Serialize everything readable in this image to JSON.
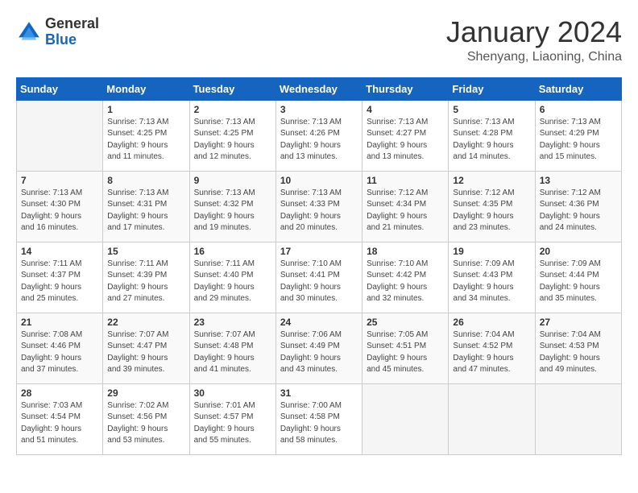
{
  "header": {
    "logo": {
      "general": "General",
      "blue": "Blue"
    },
    "title": "January 2024",
    "location": "Shenyang, Liaoning, China"
  },
  "calendar": {
    "headers": [
      "Sunday",
      "Monday",
      "Tuesday",
      "Wednesday",
      "Thursday",
      "Friday",
      "Saturday"
    ],
    "weeks": [
      [
        {
          "day": "",
          "info": ""
        },
        {
          "day": "1",
          "info": "Sunrise: 7:13 AM\nSunset: 4:25 PM\nDaylight: 9 hours\nand 11 minutes."
        },
        {
          "day": "2",
          "info": "Sunrise: 7:13 AM\nSunset: 4:25 PM\nDaylight: 9 hours\nand 12 minutes."
        },
        {
          "day": "3",
          "info": "Sunrise: 7:13 AM\nSunset: 4:26 PM\nDaylight: 9 hours\nand 13 minutes."
        },
        {
          "day": "4",
          "info": "Sunrise: 7:13 AM\nSunset: 4:27 PM\nDaylight: 9 hours\nand 13 minutes."
        },
        {
          "day": "5",
          "info": "Sunrise: 7:13 AM\nSunset: 4:28 PM\nDaylight: 9 hours\nand 14 minutes."
        },
        {
          "day": "6",
          "info": "Sunrise: 7:13 AM\nSunset: 4:29 PM\nDaylight: 9 hours\nand 15 minutes."
        }
      ],
      [
        {
          "day": "7",
          "info": ""
        },
        {
          "day": "8",
          "info": "Sunrise: 7:13 AM\nSunset: 4:31 PM\nDaylight: 9 hours\nand 17 minutes."
        },
        {
          "day": "9",
          "info": "Sunrise: 7:13 AM\nSunset: 4:32 PM\nDaylight: 9 hours\nand 19 minutes."
        },
        {
          "day": "10",
          "info": "Sunrise: 7:13 AM\nSunset: 4:33 PM\nDaylight: 9 hours\nand 20 minutes."
        },
        {
          "day": "11",
          "info": "Sunrise: 7:12 AM\nSunset: 4:34 PM\nDaylight: 9 hours\nand 21 minutes."
        },
        {
          "day": "12",
          "info": "Sunrise: 7:12 AM\nSunset: 4:35 PM\nDaylight: 9 hours\nand 23 minutes."
        },
        {
          "day": "13",
          "info": "Sunrise: 7:12 AM\nSunset: 4:36 PM\nDaylight: 9 hours\nand 24 minutes."
        }
      ],
      [
        {
          "day": "14",
          "info": ""
        },
        {
          "day": "15",
          "info": "Sunrise: 7:11 AM\nSunset: 4:39 PM\nDaylight: 9 hours\nand 27 minutes."
        },
        {
          "day": "16",
          "info": "Sunrise: 7:11 AM\nSunset: 4:40 PM\nDaylight: 9 hours\nand 29 minutes."
        },
        {
          "day": "17",
          "info": "Sunrise: 7:10 AM\nSunset: 4:41 PM\nDaylight: 9 hours\nand 30 minutes."
        },
        {
          "day": "18",
          "info": "Sunrise: 7:10 AM\nSunset: 4:42 PM\nDaylight: 9 hours\nand 32 minutes."
        },
        {
          "day": "19",
          "info": "Sunrise: 7:09 AM\nSunset: 4:43 PM\nDaylight: 9 hours\nand 34 minutes."
        },
        {
          "day": "20",
          "info": "Sunrise: 7:09 AM\nSunset: 4:44 PM\nDaylight: 9 hours\nand 35 minutes."
        }
      ],
      [
        {
          "day": "21",
          "info": "Sunrise: 7:08 AM\nSunset: 4:46 PM\nDaylight: 9 hours\nand 37 minutes."
        },
        {
          "day": "22",
          "info": "Sunrise: 7:07 AM\nSunset: 4:47 PM\nDaylight: 9 hours\nand 39 minutes."
        },
        {
          "day": "23",
          "info": "Sunrise: 7:07 AM\nSunset: 4:48 PM\nDaylight: 9 hours\nand 41 minutes."
        },
        {
          "day": "24",
          "info": "Sunrise: 7:06 AM\nSunset: 4:49 PM\nDaylight: 9 hours\nand 43 minutes."
        },
        {
          "day": "25",
          "info": "Sunrise: 7:05 AM\nSunset: 4:51 PM\nDaylight: 9 hours\nand 45 minutes."
        },
        {
          "day": "26",
          "info": "Sunrise: 7:04 AM\nSunset: 4:52 PM\nDaylight: 9 hours\nand 47 minutes."
        },
        {
          "day": "27",
          "info": "Sunrise: 7:04 AM\nSunset: 4:53 PM\nDaylight: 9 hours\nand 49 minutes."
        }
      ],
      [
        {
          "day": "28",
          "info": "Sunrise: 7:03 AM\nSunset: 4:54 PM\nDaylight: 9 hours\nand 51 minutes."
        },
        {
          "day": "29",
          "info": "Sunrise: 7:02 AM\nSunset: 4:56 PM\nDaylight: 9 hours\nand 53 minutes."
        },
        {
          "day": "30",
          "info": "Sunrise: 7:01 AM\nSunset: 4:57 PM\nDaylight: 9 hours\nand 55 minutes."
        },
        {
          "day": "31",
          "info": "Sunrise: 7:00 AM\nSunset: 4:58 PM\nDaylight: 9 hours\nand 58 minutes."
        },
        {
          "day": "",
          "info": ""
        },
        {
          "day": "",
          "info": ""
        },
        {
          "day": "",
          "info": ""
        }
      ]
    ]
  }
}
